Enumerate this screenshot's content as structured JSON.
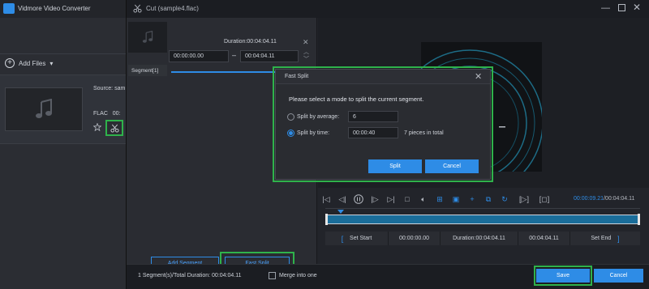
{
  "app": {
    "title": "Vidmore Video Converter",
    "add_files_label": "Add Files"
  },
  "file_item": {
    "source_text": "Source: sam",
    "format_text": "FLAC",
    "duration_partial": "00:"
  },
  "cut_window": {
    "title": "Cut (sample4.flac)"
  },
  "segment": {
    "label": "Segment[1]",
    "duration": "Duration:00:04:04.11",
    "start": "00:00:00.00",
    "end": "00:04:04.11"
  },
  "left_buttons": {
    "add_segment": "Add Segment",
    "fast_split": "Fast Split"
  },
  "player": {
    "current_time": "00:00:09.21",
    "total_time": "/00:04:04.11",
    "progress_fraction": 0.04
  },
  "set_row": {
    "set_start": "Set Start",
    "start_value": "00:00:00.00",
    "duration": "Duration:00:04:04.11",
    "end_value": "00:04:04.11",
    "set_end": "Set End"
  },
  "bottom": {
    "summary": "1 Segment(s)/Total Duration: 00:04:04.11",
    "merge_label": "Merge into one",
    "save_label": "Save",
    "cancel_label": "Cancel"
  },
  "dialog": {
    "title": "Fast Split",
    "prompt": "Please select a mode to split the current segment.",
    "option_average_label": "Split by average:",
    "average_value": "6",
    "option_time_label": "Split by time:",
    "time_value": "00:00:40",
    "pieces_text": "7 pieces in total",
    "selected_mode": "time",
    "split_label": "Split",
    "cancel_label": "Cancel"
  },
  "colors": {
    "accent": "#2e8ce6",
    "highlight": "#2fb24b"
  }
}
